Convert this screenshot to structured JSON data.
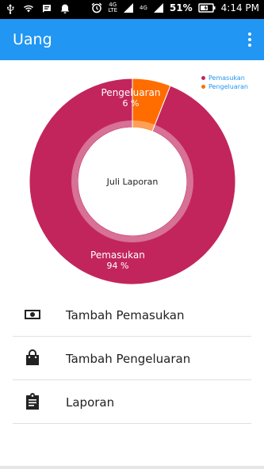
{
  "status_bar": {
    "battery_percent": "51%",
    "time": "4:14 PM",
    "network_1": "4G",
    "network_1_sub": "LTE",
    "network_2": "4G"
  },
  "app_bar": {
    "title": "Uang"
  },
  "chart_data": {
    "type": "pie",
    "variant": "donut",
    "center_text": "Juli Laporan",
    "slices": [
      {
        "name": "Pemasukan",
        "value": 94,
        "label": "94 %",
        "color": "#c2255c"
      },
      {
        "name": "Pengeluaran",
        "value": 6,
        "label": "6 %",
        "color": "#ff6d00"
      }
    ],
    "legend_placement": "top-right",
    "legend_text_color": "#2196f3"
  },
  "menu": {
    "items": [
      {
        "label": "Tambah Pemasukan",
        "icon": "money-icon"
      },
      {
        "label": "Tambah Pengeluaran",
        "icon": "shopping-bag-icon"
      },
      {
        "label": "Laporan",
        "icon": "clipboard-icon"
      }
    ]
  },
  "colors": {
    "primary": "#2196f3",
    "status_bar": "#000000"
  }
}
